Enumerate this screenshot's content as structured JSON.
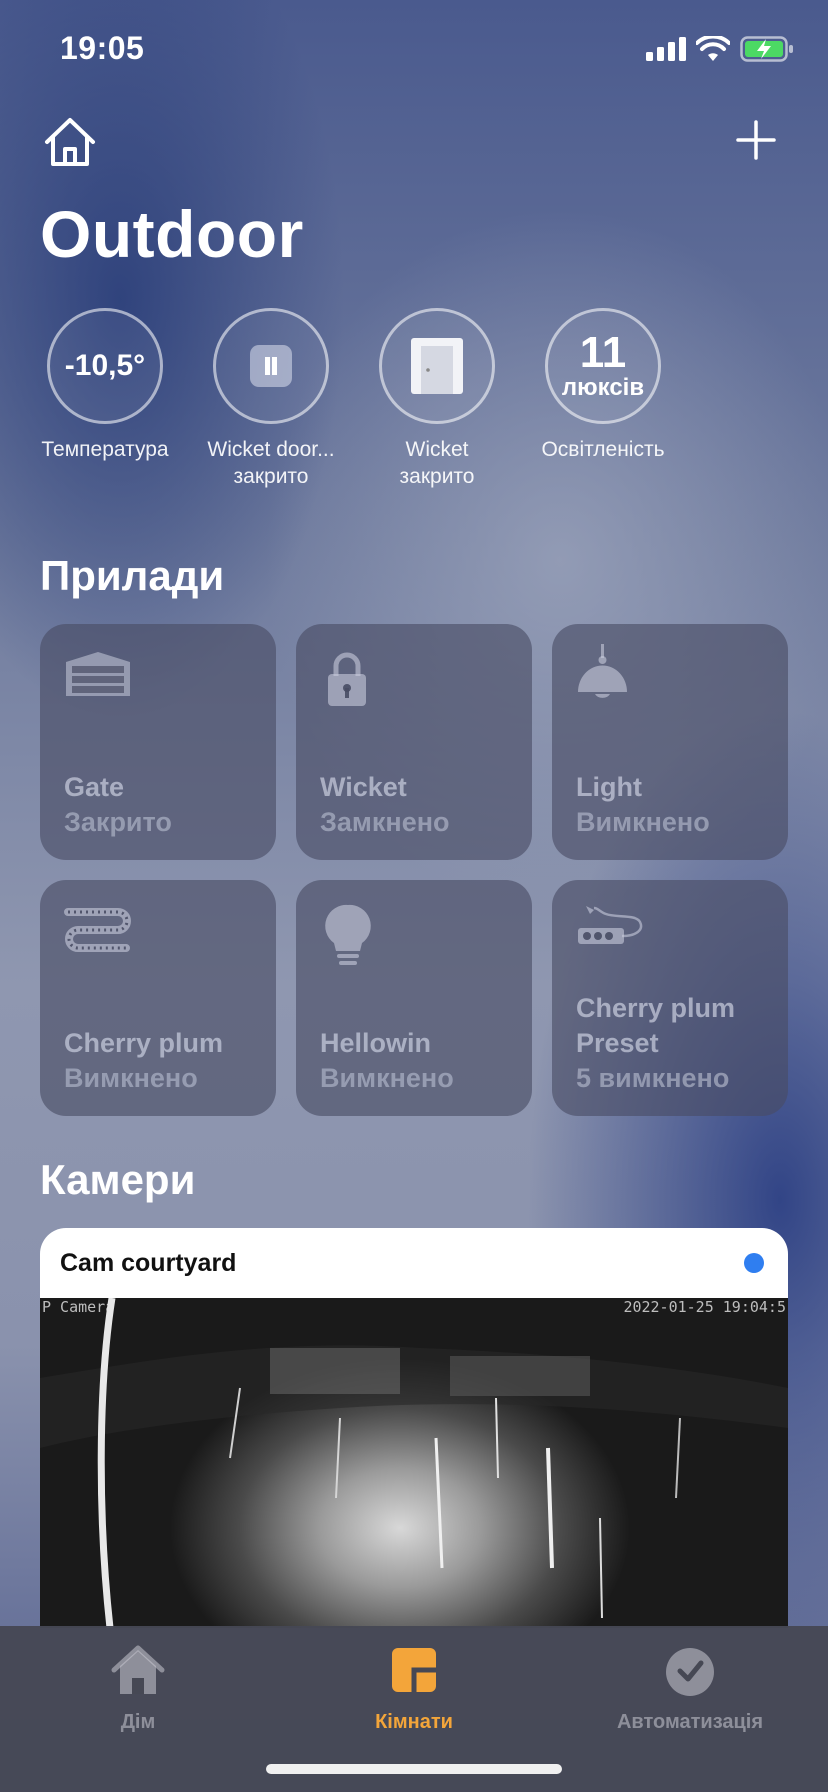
{
  "status_bar": {
    "time": "19:05"
  },
  "header": {
    "title": "Outdoor"
  },
  "status_items": [
    {
      "value": "-10,5°",
      "label_line1": "Температура",
      "label_line2": ""
    },
    {
      "value": "",
      "label_line1": "Wicket door...",
      "label_line2": "закрито"
    },
    {
      "value": "",
      "label_line1": "Wicket",
      "label_line2": "закрито"
    },
    {
      "value": "11",
      "unit": "люксів",
      "label_line1": "Освітленість",
      "label_line2": ""
    }
  ],
  "devices": {
    "title": "Прилади",
    "items": [
      {
        "name": "Gate",
        "status": "Закрито",
        "icon": "garage-door-icon"
      },
      {
        "name": "Wicket",
        "status": "Замкнено",
        "icon": "lock-icon"
      },
      {
        "name": "Light",
        "status": "Вимкнено",
        "icon": "ceiling-lamp-icon"
      },
      {
        "name": "Cherry plum",
        "status": "Вимкнено",
        "icon": "light-strip-icon"
      },
      {
        "name": "Hellowin",
        "status": "Вимкнено",
        "icon": "light-bulb-icon"
      },
      {
        "name": "Cherry plum Preset",
        "status": "5 вимкнено",
        "icon": "power-strip-icon"
      }
    ]
  },
  "cameras": {
    "title": "Камери",
    "items": [
      {
        "name": "Cam courtyard",
        "overlay_left": "P Camera",
        "overlay_right": "2022-01-25 19:04:5"
      }
    ]
  },
  "tabbar": {
    "tabs": [
      {
        "label": "Дім",
        "icon": "house-icon",
        "active": false
      },
      {
        "label": "Кімнати",
        "icon": "rooms-icon",
        "active": true
      },
      {
        "label": "Автоматизація",
        "icon": "clock-check-icon",
        "active": false
      }
    ]
  },
  "colors": {
    "accent": "#f3a53a",
    "camera_dot": "#2f7ef0"
  }
}
